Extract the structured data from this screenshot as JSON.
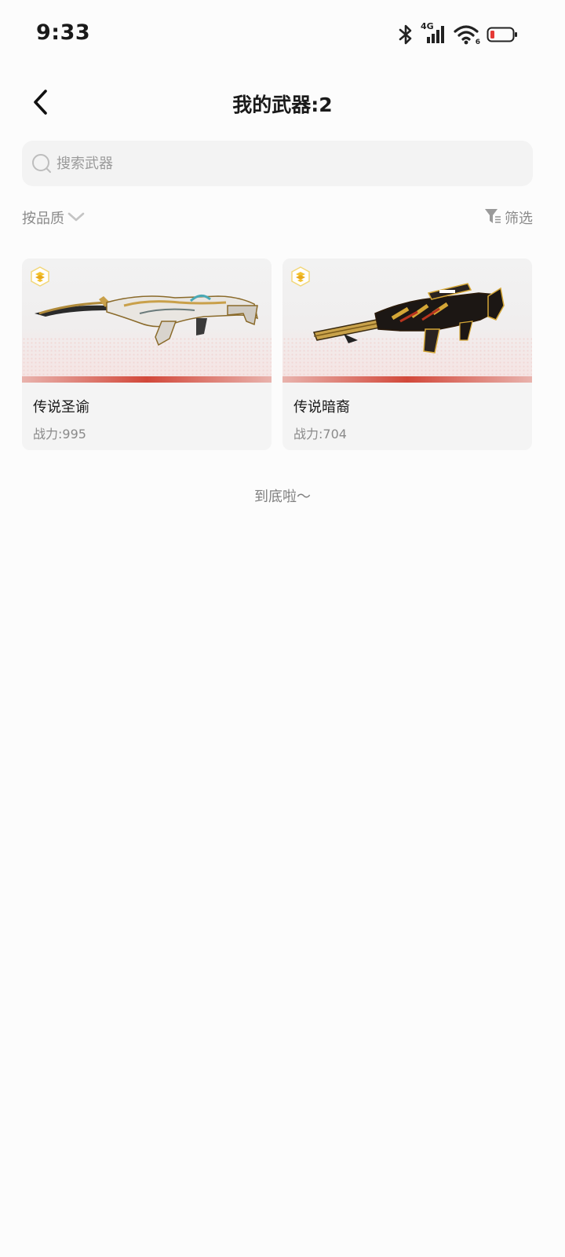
{
  "status_bar": {
    "time": "9:33",
    "network": "4G",
    "wifi_number": "6",
    "icons": [
      "bluetooth-icon",
      "cellular-signal-icon",
      "wifi-icon",
      "battery-low-icon"
    ]
  },
  "header": {
    "title": "我的武器:2",
    "back_icon": "chevron-left-icon"
  },
  "search": {
    "placeholder": "搜索武器",
    "value": ""
  },
  "filters": {
    "sort_label": "按品质",
    "filter_label": "筛选"
  },
  "weapons": [
    {
      "name": "传说圣谕",
      "power": "战力:995",
      "rarity": "legendary"
    },
    {
      "name": "传说暗裔",
      "power": "战力:704",
      "rarity": "legendary"
    }
  ],
  "list_end_text": "到底啦～",
  "colors": {
    "accent_red": "#d2483a",
    "badge_gold": "#f2c230",
    "battery_red": "#e53935"
  }
}
